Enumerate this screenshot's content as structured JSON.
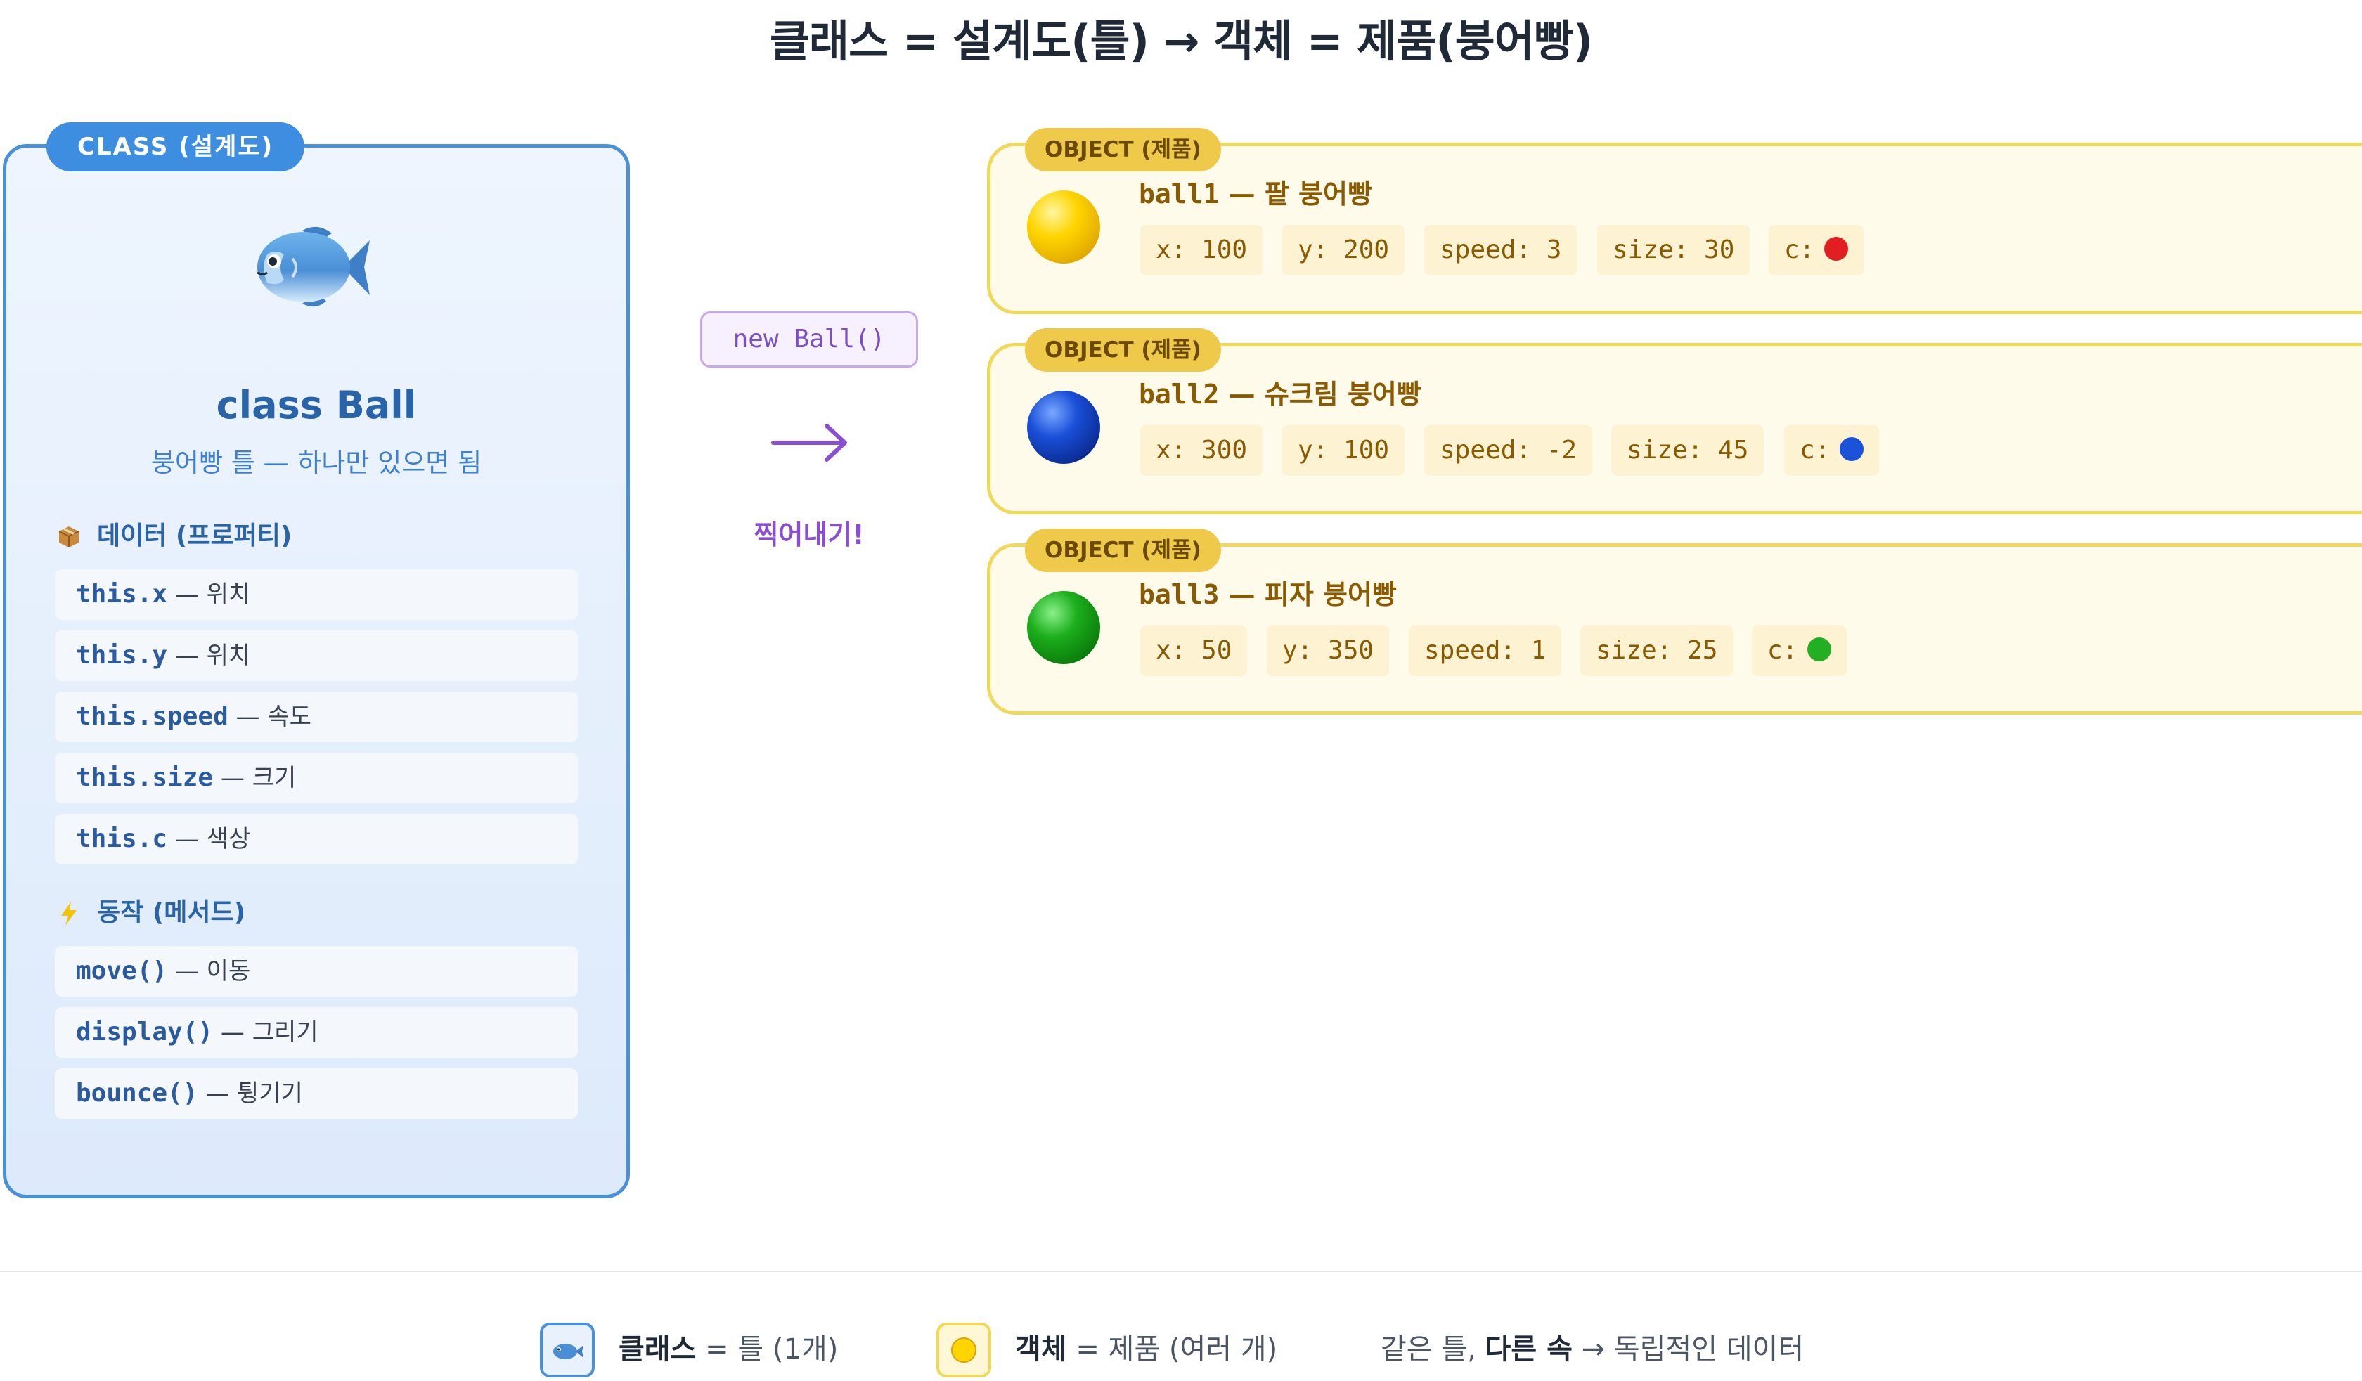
{
  "title": "클래스 = 설계도(틀) → 객체 = 제품(붕어빵)",
  "class_panel": {
    "tag": "CLASS (설계도)",
    "emoji_icon": "fish-icon",
    "name": "class Ball",
    "description": "붕어빵 틀 — 하나만 있으면 됨",
    "data_heading": "데이터 (프로퍼티)",
    "properties": [
      {
        "code": "this.x",
        "desc": "위치"
      },
      {
        "code": "this.y",
        "desc": "위치"
      },
      {
        "code": "this.speed",
        "desc": "속도"
      },
      {
        "code": "this.size",
        "desc": "크기"
      },
      {
        "code": "this.c",
        "desc": "색상"
      }
    ],
    "methods_heading": "동작 (메서드)",
    "methods": [
      {
        "code": "move()",
        "desc": "이동"
      },
      {
        "code": "display()",
        "desc": "그리기"
      },
      {
        "code": "bounce()",
        "desc": "튕기기"
      }
    ],
    "separator": " — "
  },
  "middle": {
    "constructor_call": "new Ball()",
    "arrow": "→",
    "label": "찍어내기!"
  },
  "objects": [
    {
      "tag": "OBJECT (제품)",
      "var": "ball1",
      "name": "팥 붕어빵",
      "color": "#f5c800",
      "props": [
        {
          "label": "x: ",
          "value": "100"
        },
        {
          "label": "y: ",
          "value": "200"
        },
        {
          "label": "speed: ",
          "value": "3"
        },
        {
          "label": "size: ",
          "value": "30"
        }
      ],
      "c_label": "c:",
      "c_color": "#e02020"
    },
    {
      "tag": "OBJECT (제품)",
      "var": "ball2",
      "name": "슈크림 붕어빵",
      "color": "#1646c8",
      "props": [
        {
          "label": "x: ",
          "value": "300"
        },
        {
          "label": "y: ",
          "value": "100"
        },
        {
          "label": "speed: ",
          "value": "-2"
        },
        {
          "label": "size: ",
          "value": "45"
        }
      ],
      "c_label": "c:",
      "c_color": "#1a52d8"
    },
    {
      "tag": "OBJECT (제품)",
      "var": "ball3",
      "name": "피자 붕어빵",
      "color": "#16a316",
      "props": [
        {
          "label": "x: ",
          "value": "50"
        },
        {
          "label": "y: ",
          "value": "350"
        },
        {
          "label": "speed: ",
          "value": "1"
        },
        {
          "label": "size: ",
          "value": "25"
        }
      ],
      "c_label": "c:",
      "c_color": "#22b022"
    }
  ],
  "legend": {
    "class_bold": "클래스",
    "class_rest": " = 틀 (1개)",
    "object_bold": "객체",
    "object_rest": " = 제품 (여러 개)",
    "note_pre": "같은 틀, ",
    "note_bold": "다른 속",
    "note_post": " → 독립적인 데이터"
  }
}
